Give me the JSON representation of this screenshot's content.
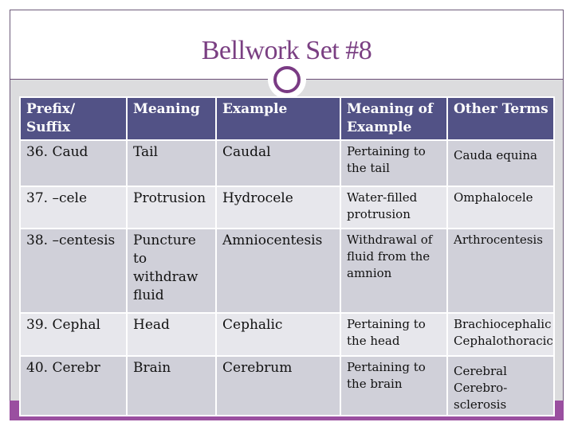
{
  "slide": {
    "title": "Bellwork Set #8",
    "colors": {
      "title": "#7a3f82",
      "header_bg": "#525286",
      "row_odd": "#d0d0d9",
      "row_even": "#e7e7ec",
      "accent": "#9a4fa0"
    }
  },
  "table": {
    "headers": [
      "Prefix/ Suffix",
      "Meaning",
      "Example",
      "Meaning of Example",
      "Other Terms"
    ],
    "rows": [
      [
        "36. Caud",
        "Tail",
        "Caudal",
        "Pertaining to the tail",
        "Cauda equina"
      ],
      [
        "37. –cele",
        "Protrusion",
        "Hydrocele",
        "Water-filled protrusion",
        "Omphalocele"
      ],
      [
        "38. –centesis",
        "Puncture to withdraw fluid",
        "Amniocentesis",
        "Withdrawal of fluid from the amnion",
        "Arthrocentesis"
      ],
      [
        "39. Cephal",
        "Head",
        "Cephalic",
        "Pertaining to the head",
        "Brachiocephalic Cephalothoracic"
      ],
      [
        "40. Cerebr",
        "Brain",
        "Cerebrum",
        "Pertaining to the brain",
        "Cerebral Cerebro-sclerosis"
      ]
    ]
  }
}
